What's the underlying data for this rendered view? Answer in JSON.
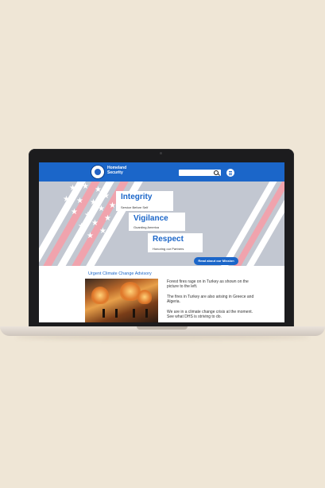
{
  "header": {
    "brand": "Homeland Security",
    "search_placeholder": ""
  },
  "hero": {
    "words": [
      {
        "title": "Integrity",
        "subtitle": "Service Before Self"
      },
      {
        "title": "Vigilance",
        "subtitle": "Guarding America"
      },
      {
        "title": "Respect",
        "subtitle": "Honoring our Partners"
      }
    ],
    "mission_button": "Read about our Mission"
  },
  "advisory": {
    "title": "Urgent Climate Change Advisory",
    "paragraphs": [
      "Forest fires rage on in Turkey as shown on the picture to the left.",
      "The fires in Turkey are also arising in Greece and Algeria.",
      "We are in a climate change crisis at the moment. See what DHS is striving to do."
    ]
  },
  "colors": {
    "accent": "#1b66c9",
    "background": "#efe6d6"
  },
  "icons": {
    "seal": "dhs-seal-icon",
    "search": "search-icon",
    "menu": "menu-icon"
  }
}
